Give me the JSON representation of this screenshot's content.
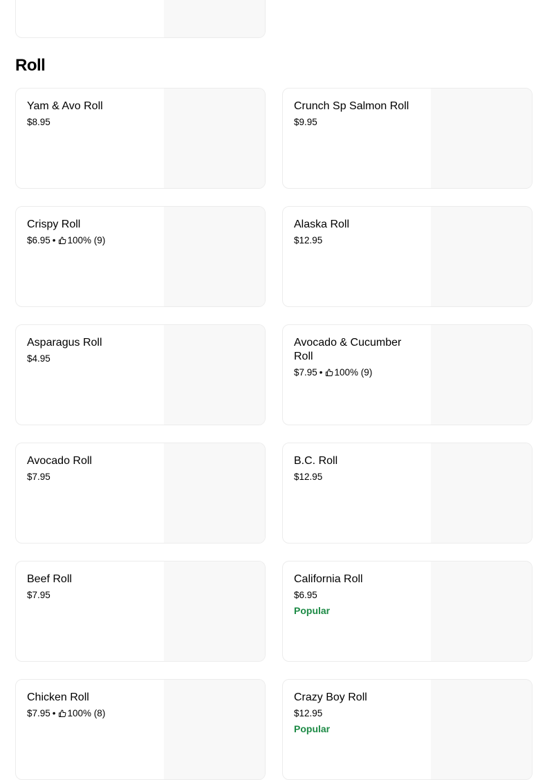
{
  "section": {
    "title": "Roll"
  },
  "items": [
    {
      "name": "Yam & Avo Roll",
      "price": "$8.95",
      "rating": "",
      "badge": ""
    },
    {
      "name": "Crunch Sp Salmon Roll",
      "price": "$9.95",
      "rating": "",
      "badge": ""
    },
    {
      "name": "Crispy Roll",
      "price": "$6.95",
      "rating": "100% (9)",
      "badge": ""
    },
    {
      "name": "Alaska Roll",
      "price": "$12.95",
      "rating": "",
      "badge": ""
    },
    {
      "name": "Asparagus Roll",
      "price": "$4.95",
      "rating": "",
      "badge": ""
    },
    {
      "name": "Avocado & Cucumber Roll",
      "price": "$7.95",
      "rating": "100% (9)",
      "badge": ""
    },
    {
      "name": "Avocado Roll",
      "price": "$7.95",
      "rating": "",
      "badge": ""
    },
    {
      "name": "B.C. Roll",
      "price": "$12.95",
      "rating": "",
      "badge": ""
    },
    {
      "name": "Beef Roll",
      "price": "$7.95",
      "rating": "",
      "badge": ""
    },
    {
      "name": "California Roll",
      "price": "$6.95",
      "rating": "",
      "badge": "Popular"
    },
    {
      "name": "Chicken Roll",
      "price": "$7.95",
      "rating": "100% (8)",
      "badge": ""
    },
    {
      "name": "Crazy Boy Roll",
      "price": "$12.95",
      "rating": "",
      "badge": "Popular"
    }
  ],
  "colors": {
    "popular": "#1c8a45",
    "image_placeholder": "#f8f8f8",
    "card_border": "#ececec"
  },
  "icons": {
    "rating": "thumbs-up-icon"
  }
}
